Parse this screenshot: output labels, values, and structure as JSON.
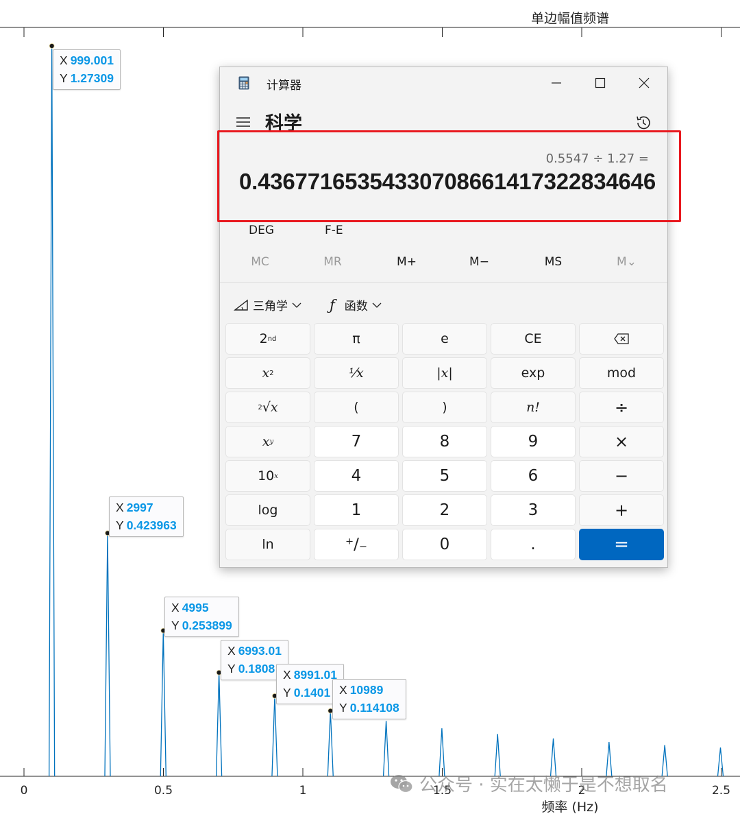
{
  "plot": {
    "title": "单边幅值频谱",
    "xlabel": "频率 (Hz)",
    "x_tick_labels": [
      "0",
      "0.5",
      "1",
      "1.5",
      "2",
      "2.5"
    ],
    "line_color": "#0072bd"
  },
  "chart_data": {
    "type": "line",
    "title": "单边幅值频谱",
    "xlabel": "频率 (Hz)",
    "ylabel": "",
    "x_tick_labels": [
      "0",
      "0.5",
      "1",
      "1.5",
      "2",
      "2.5"
    ],
    "peaks_x": [
      999.001,
      2997,
      4995,
      6993.01,
      8991.01,
      10989,
      12987,
      14985,
      16983,
      18981,
      20979,
      22977,
      24975
    ],
    "peaks_y": [
      1.27309,
      0.423963,
      0.253899,
      0.1808,
      0.1401,
      0.114108,
      0.0965,
      0.0836,
      0.0737,
      0.066,
      0.0597,
      0.0545,
      0.0501
    ],
    "xlim": [
      0,
      25000
    ],
    "ylim": [
      0,
      1.3
    ],
    "grid": false
  },
  "datatips": [
    {
      "x_label": "X",
      "x": "999.001",
      "y_label": "Y",
      "y": "1.27309"
    },
    {
      "x_label": "X",
      "x": "2997",
      "y_label": "Y",
      "y": "0.423963"
    },
    {
      "x_label": "X",
      "x": "4995",
      "y_label": "Y",
      "y": "0.253899"
    },
    {
      "x_label": "X",
      "x": "6993.01",
      "y_label": "Y",
      "y": "0.1808"
    },
    {
      "x_label": "X",
      "x": "8991.01",
      "y_label": "Y",
      "y": "0.1401"
    },
    {
      "x_label": "X",
      "x": "10989",
      "y_label": "Y",
      "y": "0.114108"
    }
  ],
  "calculator": {
    "window_title": "计算器",
    "mode": "科学",
    "expression": "0.5547 ÷ 1.27 =",
    "result": "0.43677165354330708661417322834646",
    "angle_mode": "DEG",
    "fe_label": "F-E",
    "memory": [
      "MC",
      "MR",
      "M+",
      "M−",
      "MS",
      "M⌄"
    ],
    "trig_label": "三角学",
    "func_label": "函数",
    "accent_color": "#0067c0",
    "highlight_color": "#e8191f",
    "keys": {
      "second": "2",
      "second_sup": "nd",
      "pi": "π",
      "e": "e",
      "ce": "CE",
      "x2": "x",
      "x2_sup": "2",
      "recip": "⅟x",
      "abs": "|x|",
      "exp": "exp",
      "mod": "mod",
      "root_sup": "2",
      "root": "√x",
      "lparen": "(",
      "rparen": ")",
      "fact": "n!",
      "div": "÷",
      "xy": "x",
      "xy_sup": "y",
      "k7": "7",
      "k8": "8",
      "k9": "9",
      "mul": "×",
      "ten": "10",
      "ten_sup": "x",
      "k4": "4",
      "k5": "5",
      "k6": "6",
      "minus": "−",
      "log": "log",
      "k1": "1",
      "k2": "2",
      "k3": "3",
      "plus": "+",
      "ln": "ln",
      "neg": "⁺∕₋",
      "k0": "0",
      "dot": ".",
      "eq": "="
    }
  },
  "watermark": {
    "text": "公众号 · 实在太懒于是不想取名"
  }
}
